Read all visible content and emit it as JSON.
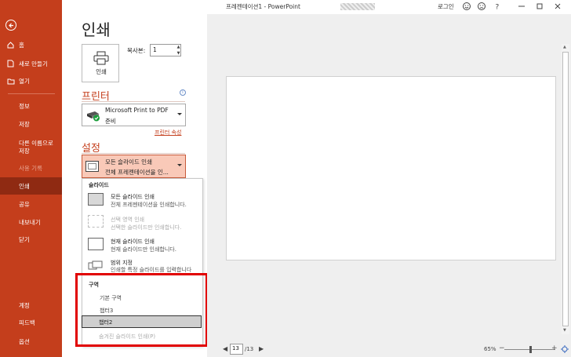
{
  "titlebar": {
    "title": "프레젠테이션1 - PowerPoint",
    "login": "로그인"
  },
  "sidebar": {
    "items": [
      {
        "label": "홈"
      },
      {
        "label": "새로 만들기"
      },
      {
        "label": "열기"
      },
      {
        "label": "정보"
      },
      {
        "label": "저장"
      },
      {
        "label": "다른 이름으로 저장"
      },
      {
        "label": "사용 기록"
      },
      {
        "label": "인쇄"
      },
      {
        "label": "공유"
      },
      {
        "label": "내보내기"
      },
      {
        "label": "닫기"
      },
      {
        "label": "계정"
      },
      {
        "label": "피드백"
      },
      {
        "label": "옵션"
      }
    ]
  },
  "main": {
    "title": "인쇄",
    "print_button": "인쇄",
    "copies_label": "복사본:",
    "copies_value": "1"
  },
  "printer": {
    "heading": "프린터",
    "name": "Microsoft Print to PDF",
    "status": "준비",
    "properties_link": "프린터 속성"
  },
  "settings": {
    "heading": "설정",
    "selected_title": "모든 슬라이드 인쇄",
    "selected_sub": "전체 프레젠테이션을 인..."
  },
  "menu": {
    "slides_header": "슬라이드",
    "items": [
      {
        "title": "모든 슬라이드 인쇄",
        "sub": "전체 프레젠테이션을 인쇄합니다."
      },
      {
        "title": "선택 영역 인쇄",
        "sub": "선택한 슬라이드만 인쇄합니다."
      },
      {
        "title": "현재 슬라이드 인쇄",
        "sub": "현재 슬라이드만 인쇄합니다."
      },
      {
        "title": "범위 지정",
        "sub": "인쇄할 특정 슬라이드를 입력합니다"
      }
    ],
    "sections_header": "구역",
    "sections": [
      {
        "label": "기본 구역"
      },
      {
        "label": "챕터3"
      },
      {
        "label": "챕터2"
      },
      {
        "label": "숨겨진 슬라이드 인쇄(P)"
      }
    ]
  },
  "preview": {
    "current_page": "13",
    "total_pages": "/13",
    "zoom": "65%"
  },
  "colors": {
    "accent": "#c43e1c",
    "highlight": "#e10000"
  }
}
